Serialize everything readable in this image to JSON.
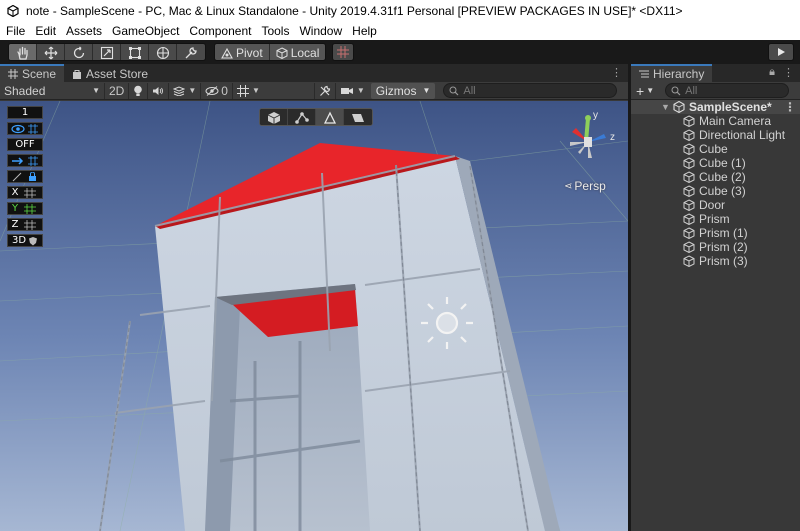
{
  "window": {
    "title": "note - SampleScene - PC, Mac & Linux Standalone - Unity 2019.4.31f1 Personal [PREVIEW PACKAGES IN USE]* <DX11>"
  },
  "menu": [
    "File",
    "Edit",
    "Assets",
    "GameObject",
    "Component",
    "Tools",
    "Window",
    "Help"
  ],
  "toolbar": {
    "tools": [
      "hand-tool",
      "move-tool",
      "rotate-tool",
      "scale-tool",
      "rect-tool",
      "transform-tool",
      "custom-tool"
    ],
    "pivot_label": "Pivot",
    "local_label": "Local",
    "play_icon": "play-icon"
  },
  "scene_panel": {
    "tabs": [
      {
        "label": "Scene",
        "icon": "grid-icon",
        "active": true
      },
      {
        "label": "Asset Store",
        "icon": "bag-icon",
        "active": false
      }
    ],
    "shading_mode": "Shaded",
    "mode_2d": "2D",
    "hidden_count": "0",
    "gizmos_label": "Gizmos",
    "search_placeholder": "All",
    "persp_label": "Persp",
    "overlay_tools": [
      "1",
      "eye",
      "OFF",
      "arrow",
      "ruler",
      "X",
      "Y",
      "Z",
      "3D"
    ],
    "gizmo_axes": {
      "y": "y",
      "z": "z"
    }
  },
  "hierarchy": {
    "tab_label": "Hierarchy",
    "add_label": "+",
    "search_placeholder": "All",
    "scene_name": "SampleScene*",
    "items": [
      "Main Camera",
      "Directional Light",
      "Cube",
      "Cube (1)",
      "Cube (2)",
      "Cube (3)",
      "Door",
      "Prism",
      "Prism (1)",
      "Prism (2)",
      "Prism (3)"
    ]
  },
  "colors": {
    "accent": "#3a79bb",
    "roof": "#e8252a",
    "sky_top": "#3f5a8f",
    "sky_bottom": "#9aaed0",
    "panel_bg": "#383838"
  }
}
